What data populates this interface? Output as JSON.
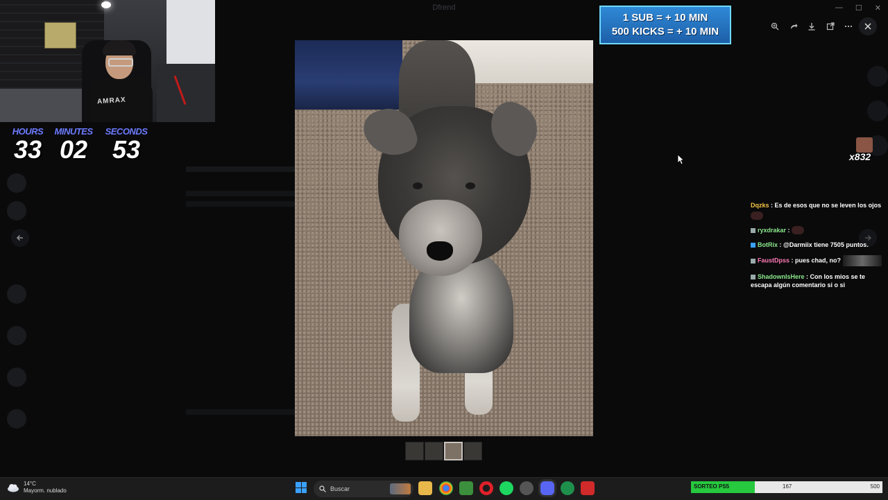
{
  "app": {
    "title": "Dfrend"
  },
  "webcam": {
    "shirt_text": "AMRAX"
  },
  "timer": {
    "hours_label": "HOURS",
    "hours": "33",
    "minutes_label": "MINUTES",
    "minutes": "02",
    "seconds_label": "SECONDS",
    "seconds": "53"
  },
  "sub_banner": {
    "line1": "1 SUB = + 10 MIN",
    "line2": "500 KICKS = + 10 MIN"
  },
  "viewer": {
    "toolbar_icons": [
      "zoom-in-icon",
      "forward-icon",
      "download-icon",
      "open-external-icon",
      "more-icon"
    ],
    "thumbnails_count": 4,
    "active_thumbnail": 3
  },
  "sub_counter": {
    "count": "x832"
  },
  "chat": [
    {
      "user": "Dqzks",
      "user_color": "#f5c542",
      "text": "Es de esos que no se leven los ojos",
      "emote": true
    },
    {
      "user": "ryxdrakar",
      "user_color": "#8be88b",
      "text": "",
      "emote": true
    },
    {
      "user": "BotRix",
      "user_color": "#8be88b",
      "text": "@Darmiix tiene 7505 puntos.",
      "emote": false
    },
    {
      "user": "FaustDpss",
      "user_color": "#ff7ab6",
      "text": "pues chad, no?",
      "emote": true
    },
    {
      "user": "ShadownIsHere",
      "user_color": "#8be88b",
      "text": "Con los mios se te escapa algún comentario si o si",
      "emote": false
    }
  ],
  "taskbar": {
    "weather_temp": "14°C",
    "weather_desc": "Mayorm. nublado",
    "search_placeholder": "Buscar",
    "sorteo_label": "SORTEO PS5",
    "sorteo_value": "167",
    "sorteo_max": "500"
  },
  "colors": {
    "accent": "#6c7bff",
    "banner": "#2f89d6",
    "progress": "#27c93f"
  }
}
